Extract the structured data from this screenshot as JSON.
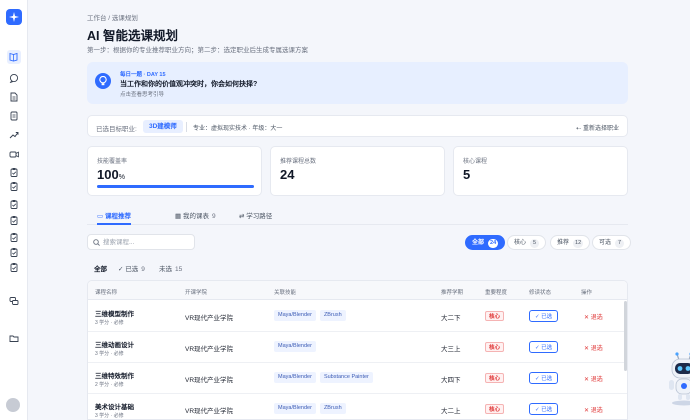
{
  "rail": {
    "items": [
      {
        "name": "rail-item-course-planning",
        "icon": "book-icon",
        "active": true
      },
      {
        "name": "rail-item-chat",
        "icon": "chat-icon"
      },
      {
        "name": "rail-item-document",
        "icon": "document-icon"
      },
      {
        "name": "rail-item-report",
        "icon": "report-icon"
      },
      {
        "name": "rail-item-trend",
        "icon": "trend-icon"
      },
      {
        "name": "rail-item-video",
        "icon": "video-icon"
      },
      {
        "name": "rail-item-clipboard-1",
        "icon": "clipboard-icon"
      },
      {
        "name": "rail-item-clipboard-2",
        "icon": "clipboard-icon"
      },
      {
        "name": "rail-item-clipboard-3",
        "icon": "clipboard-icon"
      },
      {
        "name": "rail-item-clipboard-4",
        "icon": "clipboard-icon"
      },
      {
        "name": "rail-item-clipboard-5",
        "icon": "clipboard-icon"
      },
      {
        "name": "rail-item-clipboard-6",
        "icon": "clipboard-icon"
      },
      {
        "name": "rail-item-clipboard-7",
        "icon": "clipboard-icon"
      },
      {
        "name": "rail-item-messages",
        "icon": "messages-icon"
      },
      {
        "name": "rail-item-folder",
        "icon": "folder-icon"
      }
    ]
  },
  "header": {
    "breadcrumb": "工作台 / 选课规划",
    "title": "AI 智能选课规划",
    "subtitle": "第一步：根据你的专业推荐职业方向；第二步：选定职业后生成专属选课方案"
  },
  "daily": {
    "tag": "每日一题 · DAY 15",
    "question": "当工作和你的价值观冲突时，你会如何抉择?",
    "hint": "点击查看思考引导"
  },
  "career": {
    "label": "已选目标职业:",
    "value": "3D建模师",
    "meta": "专业：虚拟现实技术 · 年级：大一",
    "reselect": "重新选择职业"
  },
  "stats": [
    {
      "label": "技能覆盖率",
      "value": "100",
      "unit": "%",
      "progress": 1.0
    },
    {
      "label": "推荐课程总数",
      "value": "24"
    },
    {
      "label": "核心课程",
      "value": "5"
    }
  ],
  "tabs": [
    {
      "label": "课程推荐",
      "icon": "book-icon",
      "active": true
    },
    {
      "label": "我的课表",
      "icon": "calendar-icon",
      "count": "9"
    },
    {
      "label": "学习路径",
      "icon": "route-icon"
    }
  ],
  "search": {
    "placeholder": "搜索课程..."
  },
  "segments": [
    {
      "label": "全部",
      "count": "24",
      "active": true
    },
    {
      "label": "核心",
      "count": "5"
    },
    {
      "label": "推荐",
      "count": "12"
    },
    {
      "label": "可选",
      "count": "7"
    }
  ],
  "filters": [
    {
      "label": "全部",
      "active": true
    },
    {
      "label": "✓ 已选",
      "count": "9"
    },
    {
      "label": "未选",
      "count": "15"
    }
  ],
  "table": {
    "headers": [
      "课程名称",
      "开课学院",
      "关联技能",
      "推荐学期",
      "重要程度",
      "修读状态",
      "操作"
    ],
    "rows": [
      {
        "name": "三维模型制作",
        "sub": "3 学分 · 必修",
        "college": "VR现代产业学院",
        "skills": [
          "Maya/Blender",
          "ZBrush"
        ],
        "semester": "大二下",
        "priority": "核心",
        "status": "✓ 已选",
        "action": "✕ 退选"
      },
      {
        "name": "三维动画设计",
        "sub": "3 学分 · 必修",
        "college": "VR现代产业学院",
        "skills": [
          "Maya/Blender"
        ],
        "semester": "大三上",
        "priority": "核心",
        "status": "✓ 已选",
        "action": "✕ 退选"
      },
      {
        "name": "三维特效制作",
        "sub": "2 学分 · 必修",
        "college": "VR现代产业学院",
        "skills": [
          "Maya/Blender",
          "Substance Painter"
        ],
        "semester": "大四下",
        "priority": "核心",
        "status": "✓ 已选",
        "action": "✕ 退选"
      },
      {
        "name": "美术设计基础",
        "sub": "3 学分 · 必修",
        "college": "VR现代产业学院",
        "skills": [
          "Maya/Blender",
          "ZBrush"
        ],
        "semester": "大二上",
        "priority": "核心",
        "status": "✓ 已选",
        "action": "✕ 退选"
      }
    ]
  },
  "colors": {
    "accent": "#2f6bff",
    "danger": "#e03a3a",
    "background": "#f4f6fb"
  }
}
